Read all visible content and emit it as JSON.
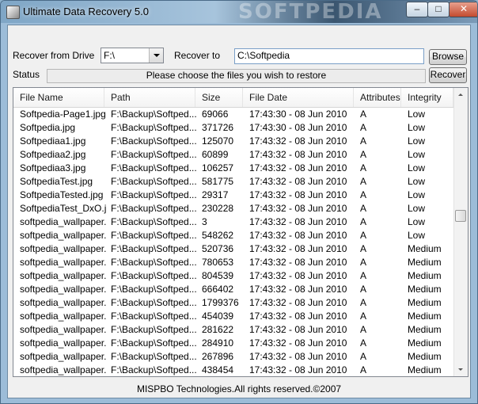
{
  "window": {
    "title": "Ultimate Data Recovery 5.0",
    "watermark": "SOFTPEDIA",
    "minimize_glyph": "–",
    "maximize_glyph": "□",
    "close_glyph": "✕"
  },
  "form": {
    "recover_from_label": "Recover from Drive",
    "drive_value": "F:\\",
    "recover_to_label": "Recover to",
    "recover_to_value": "C:\\Softpedia",
    "browse_label": "Browse",
    "status_label": "Status",
    "status_text": "Please choose the files you wish to restore",
    "recover_label": "Recover"
  },
  "table": {
    "columns": [
      "File Name",
      "Path",
      "Size",
      "File Date",
      "Attributes",
      "Integrity"
    ],
    "rows": [
      [
        "Softpedia-Page1.jpg",
        "F:\\Backup\\Softped...",
        "69066",
        "17:43:30 - 08 Jun 2010",
        "A",
        "Low"
      ],
      [
        "Softpedia.jpg",
        "F:\\Backup\\Softped...",
        "371726",
        "17:43:30 - 08 Jun 2010",
        "A",
        "Low"
      ],
      [
        "Softpediaa1.jpg",
        "F:\\Backup\\Softped...",
        "125070",
        "17:43:32 - 08 Jun 2010",
        "A",
        "Low"
      ],
      [
        "Softpediaa2.jpg",
        "F:\\Backup\\Softped...",
        "60899",
        "17:43:32 - 08 Jun 2010",
        "A",
        "Low"
      ],
      [
        "Softpediaa3.jpg",
        "F:\\Backup\\Softped...",
        "106257",
        "17:43:32 - 08 Jun 2010",
        "A",
        "Low"
      ],
      [
        "SoftpediaTest.jpg",
        "F:\\Backup\\Softped...",
        "581775",
        "17:43:32 - 08 Jun 2010",
        "A",
        "Low"
      ],
      [
        "SoftpediaTested.jpg",
        "F:\\Backup\\Softped...",
        "29317",
        "17:43:32 - 08 Jun 2010",
        "A",
        "Low"
      ],
      [
        "SoftpediaTest_DxO.j...",
        "F:\\Backup\\Softped...",
        "230228",
        "17:43:32 - 08 Jun 2010",
        "A",
        "Low"
      ],
      [
        "softpedia_wallpaper...",
        "F:\\Backup\\Softped...",
        "3",
        "17:43:32 - 08 Jun 2010",
        "A",
        "Low"
      ],
      [
        "softpedia_wallpaper...",
        "F:\\Backup\\Softped...",
        "548262",
        "17:43:32 - 08 Jun 2010",
        "A",
        "Low"
      ],
      [
        "softpedia_wallpaper...",
        "F:\\Backup\\Softped...",
        "520736",
        "17:43:32 - 08 Jun 2010",
        "A",
        "Medium"
      ],
      [
        "softpedia_wallpaper...",
        "F:\\Backup\\Softped...",
        "780653",
        "17:43:32 - 08 Jun 2010",
        "A",
        "Medium"
      ],
      [
        "softpedia_wallpaper...",
        "F:\\Backup\\Softped...",
        "804539",
        "17:43:32 - 08 Jun 2010",
        "A",
        "Medium"
      ],
      [
        "softpedia_wallpaper...",
        "F:\\Backup\\Softped...",
        "666402",
        "17:43:32 - 08 Jun 2010",
        "A",
        "Medium"
      ],
      [
        "softpedia_wallpaper...",
        "F:\\Backup\\Softped...",
        "1799376",
        "17:43:32 - 08 Jun 2010",
        "A",
        "Medium"
      ],
      [
        "softpedia_wallpaper...",
        "F:\\Backup\\Softped...",
        "454039",
        "17:43:32 - 08 Jun 2010",
        "A",
        "Medium"
      ],
      [
        "softpedia_wallpaper...",
        "F:\\Backup\\Softped...",
        "281622",
        "17:43:32 - 08 Jun 2010",
        "A",
        "Medium"
      ],
      [
        "softpedia_wallpaper...",
        "F:\\Backup\\Softped...",
        "284910",
        "17:43:32 - 08 Jun 2010",
        "A",
        "Medium"
      ],
      [
        "softpedia_wallpaper...",
        "F:\\Backup\\Softped...",
        "267896",
        "17:43:32 - 08 Jun 2010",
        "A",
        "Medium"
      ],
      [
        "softpedia_wallpaper...",
        "F:\\Backup\\Softped...",
        "438454",
        "17:43:32 - 08 Jun 2010",
        "A",
        "Medium"
      ]
    ]
  },
  "footer": {
    "copyright": "MISPBO Technologies.All rights reserved.©2007"
  }
}
